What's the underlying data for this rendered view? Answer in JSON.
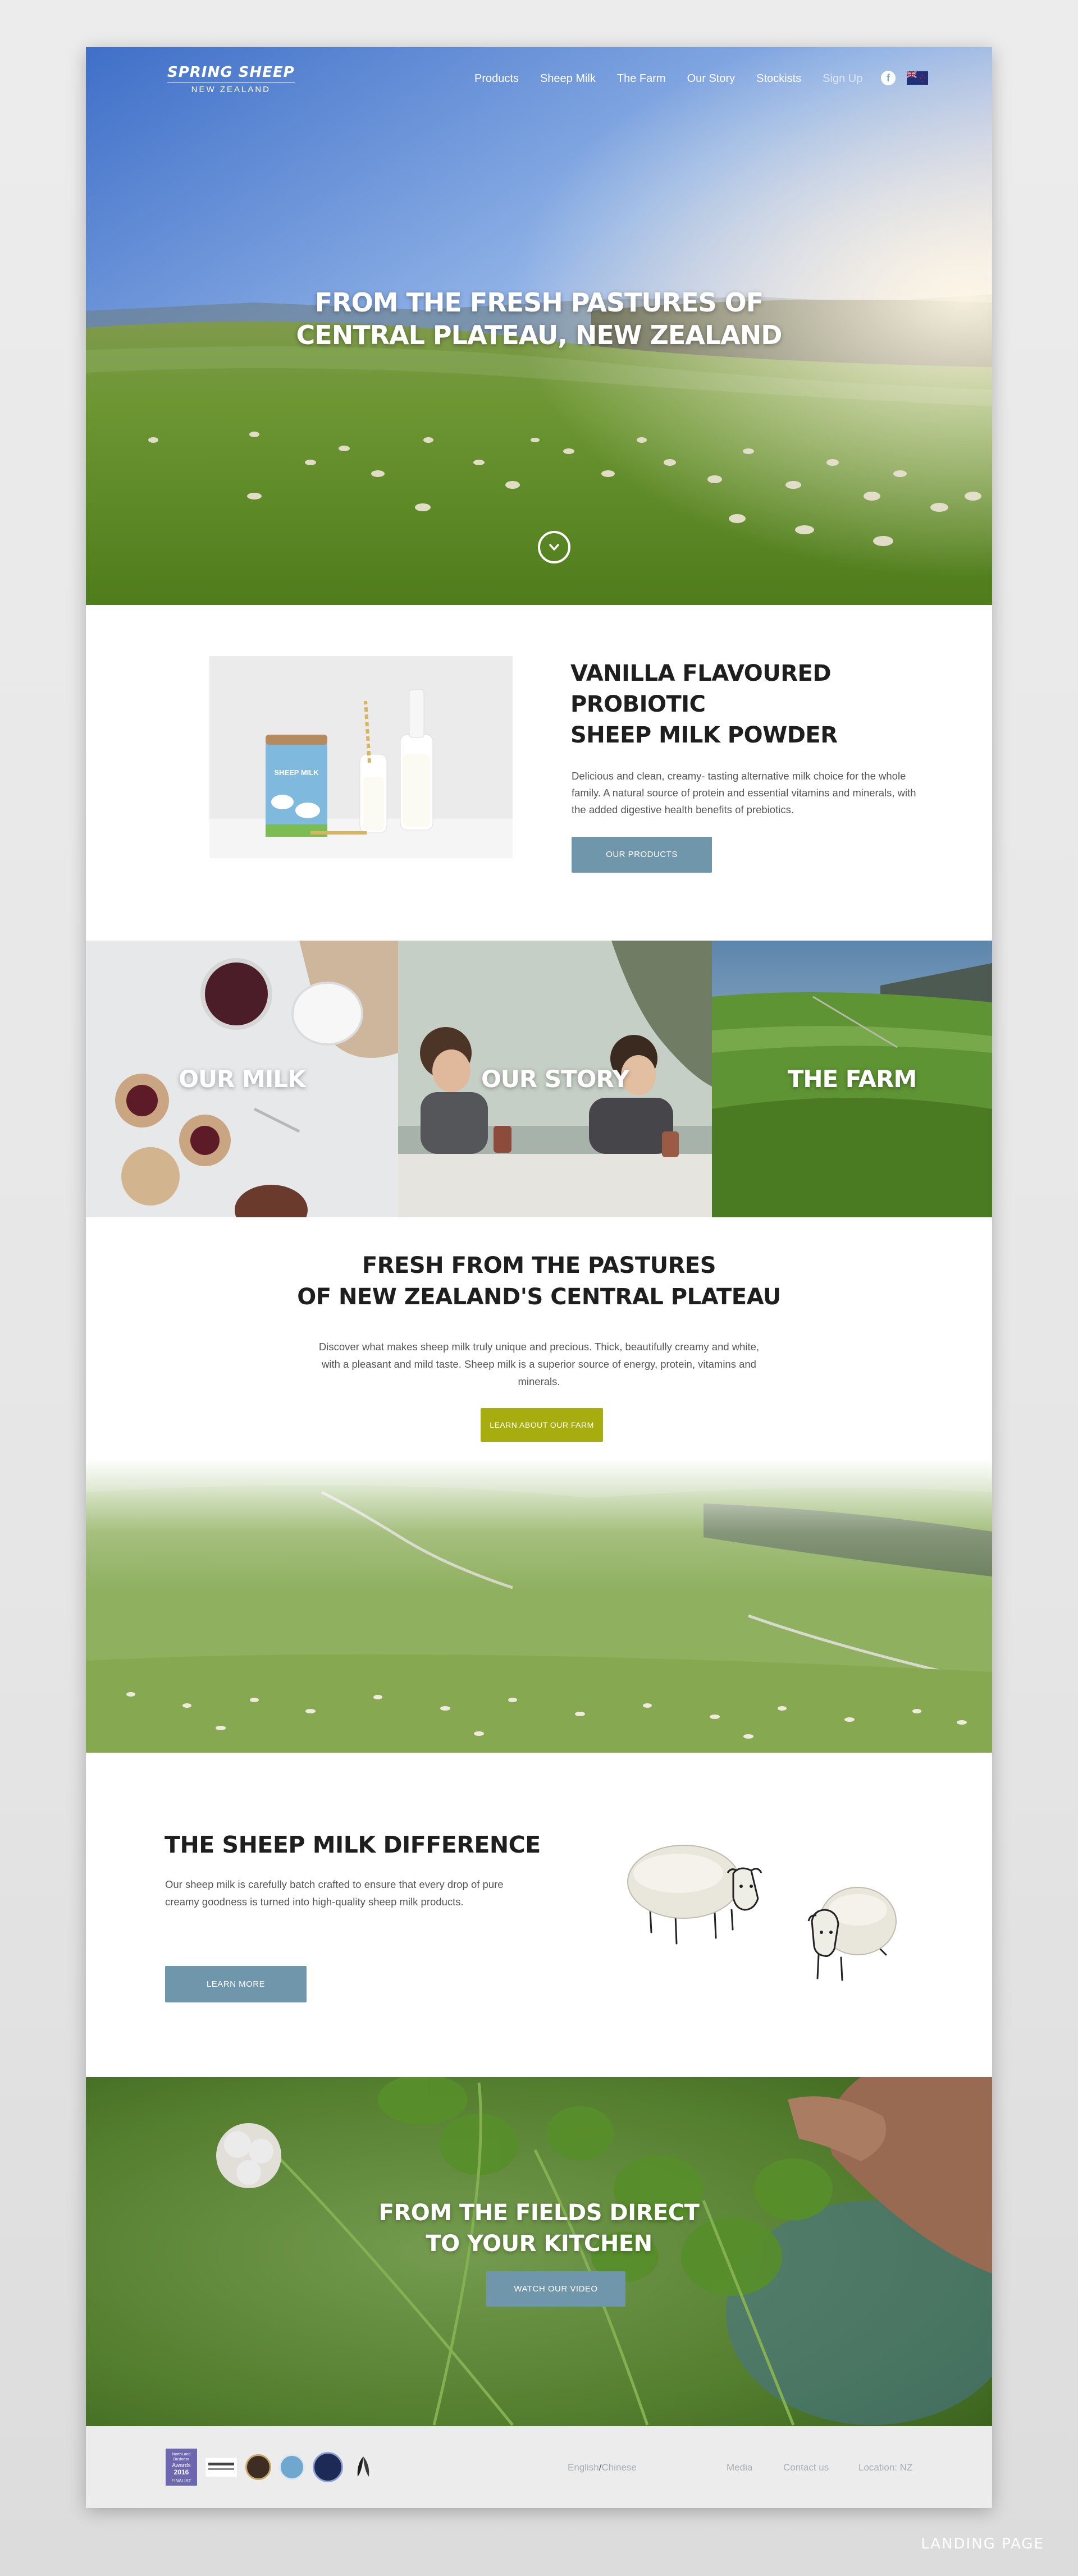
{
  "nav": {
    "logo_top": "SPRING SHEEP",
    "logo_bottom": "NEW ZEALAND",
    "links": [
      "Products",
      "Sheep Milk",
      "The Farm",
      "Our Story",
      "Stockists",
      "Sign Up"
    ],
    "facebook_glyph": "f",
    "icons": [
      "facebook-icon",
      "new-zealand-flag-icon"
    ]
  },
  "hero": {
    "line1": "FROM THE FRESH PASTURES OF",
    "line2": "CENTRAL PLATEAU, NEW ZEALAND",
    "scroll_icon": "chevron-down-circle-icon"
  },
  "product": {
    "title_lines": [
      "VANILLA FLAVOURED",
      "PROBIOTIC",
      "SHEEP MILK POWDER"
    ],
    "description": "Delicious and clean, creamy- tasting alternative milk choice for the whole family. A natural source of protein and essential vitamins and minerals, with the added digestive health benefits of prebiotics.",
    "button": "OUR PRODUCTS",
    "can_label": "SHEEP MILK"
  },
  "tiles": [
    "OUR MILK",
    "OUR STORY",
    "THE FARM"
  ],
  "farm": {
    "title_lines": [
      "FRESH FROM THE PASTURES",
      "OF NEW ZEALAND'S CENTRAL PLATEAU"
    ],
    "description": "Discover what makes sheep milk truly unique and precious. Thick, beautifully creamy and white, with a pleasant and mild taste. Sheep milk is a superior source of energy, protein, vitamins and minerals.",
    "button": "LEARN ABOUT OUR FARM"
  },
  "difference": {
    "title": "THE SHEEP MILK DIFFERENCE",
    "description": "Our sheep milk is carefully batch crafted to ensure that every drop of pure creamy goodness is turned into high-quality sheep milk products.",
    "button": "LEARN MORE"
  },
  "video": {
    "title_lines": [
      "FROM THE FIELDS DIRECT",
      "TO YOUR KITCHEN"
    ],
    "button": "WATCH OUR VIDEO"
  },
  "footer": {
    "award_lines": [
      "NorthLand",
      "Business",
      "Awards",
      "2016",
      "FINALIST"
    ],
    "lang_english": "English",
    "lang_sep": "/",
    "lang_chinese": "Chinese",
    "links": [
      "Media",
      "Contact us",
      "Location: NZ"
    ]
  },
  "caption": "LANDING PAGE",
  "colors": {
    "button_blue": "#7096ab",
    "button_green": "#a7ad0f",
    "footer_bg": "#ececec",
    "footer_text": "#a6aeb3"
  }
}
